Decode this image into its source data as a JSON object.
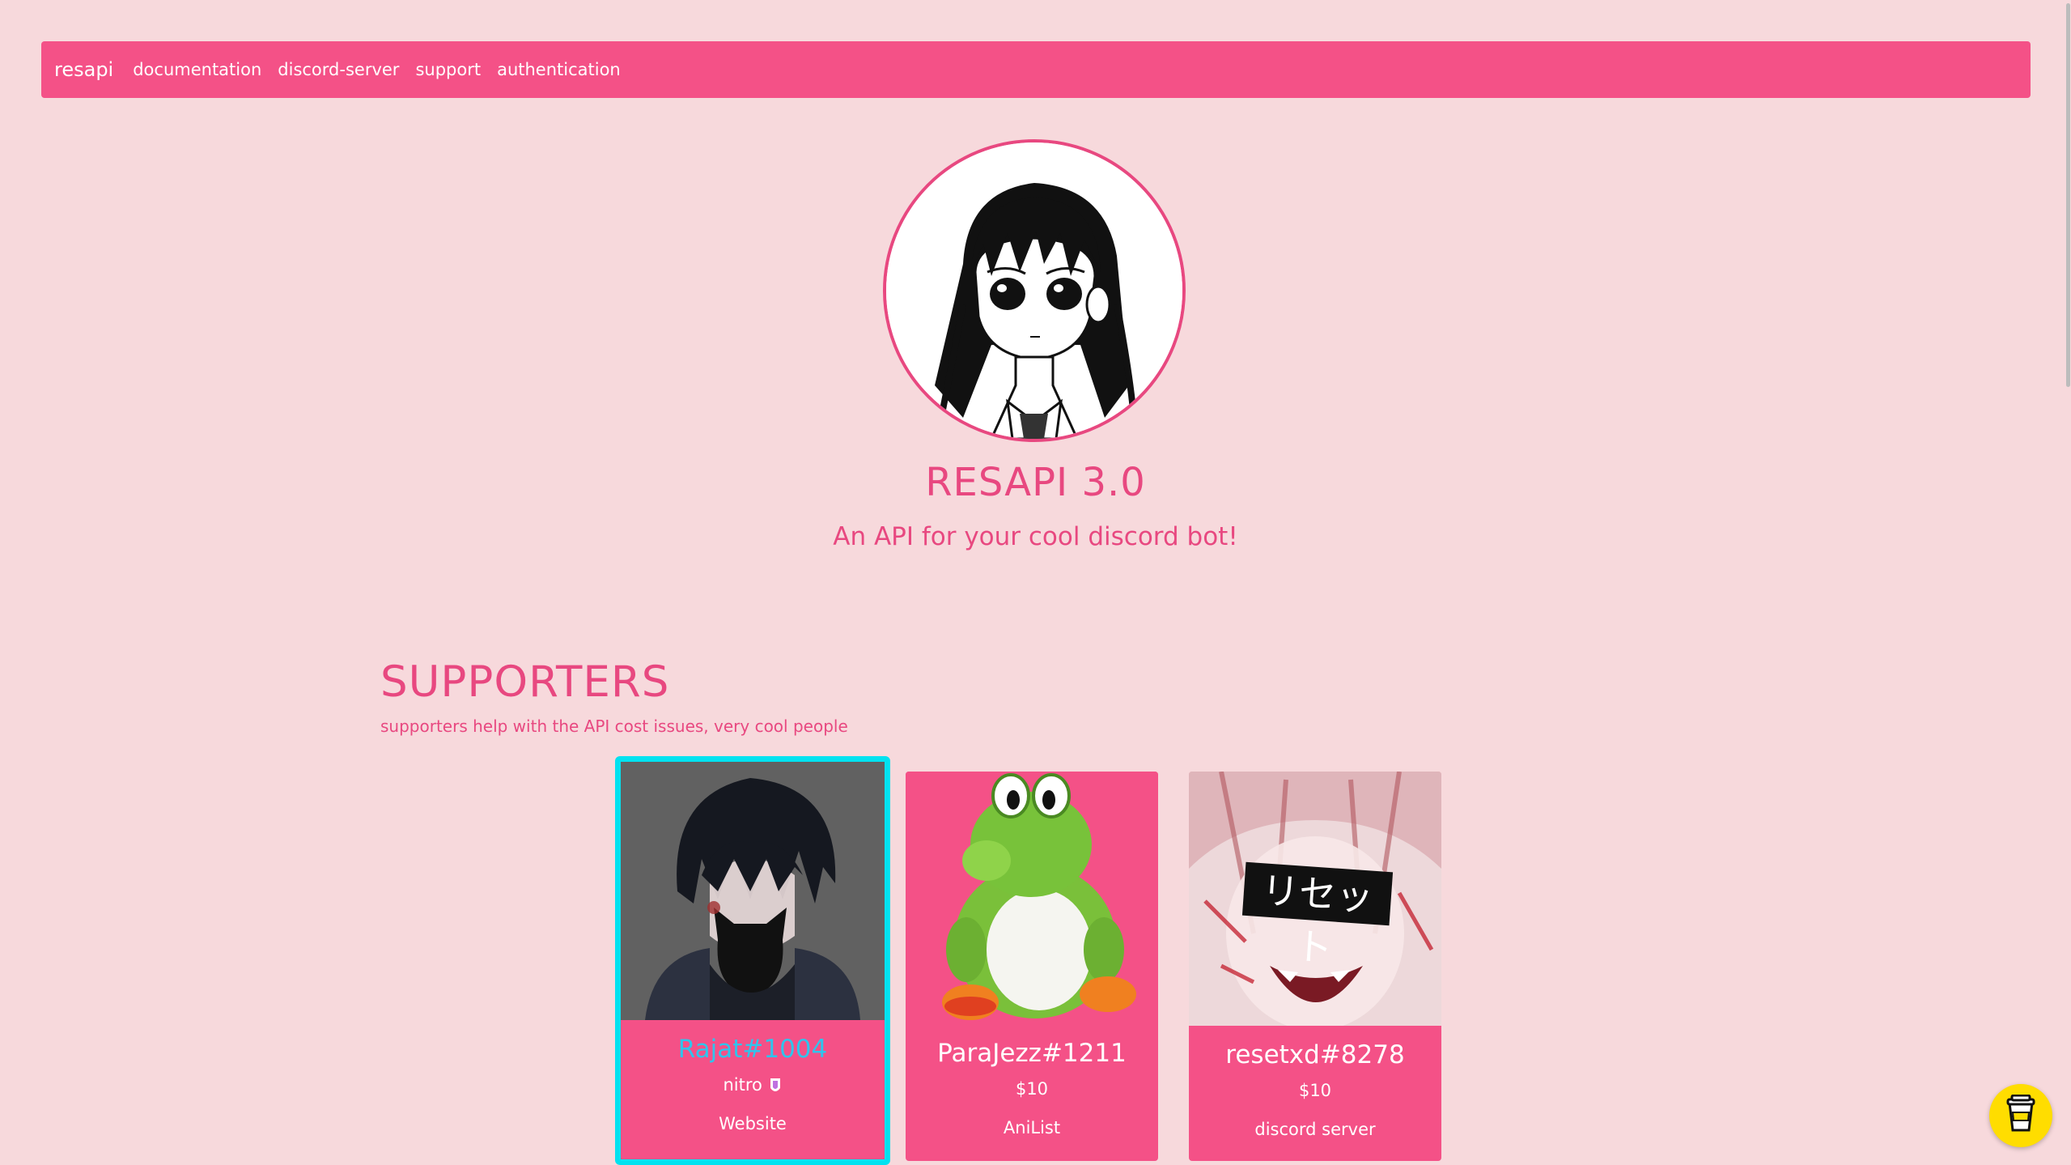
{
  "nav": {
    "brand": "resapi",
    "links": [
      "documentation",
      "discord-server",
      "support",
      "authentication"
    ]
  },
  "hero": {
    "title": "RESAPI 3.0",
    "subtitle": "An API for your cool discord bot!"
  },
  "supporters": {
    "title": "SUPPORTERS",
    "description": "supporters help with the API cost issues, very cool people",
    "cards": [
      {
        "name": "Rajat#1004",
        "amount": "nitro",
        "link": "Website",
        "highlighted": true,
        "name_color": "#2fc4ec"
      },
      {
        "name": "ParaJezz#1211",
        "amount": "$10",
        "link": "AniList",
        "highlighted": false
      },
      {
        "name": "resetxd#8278",
        "amount": "$10",
        "link": "discord server",
        "highlighted": false,
        "image_text": "リセット"
      }
    ]
  },
  "colors": {
    "background": "#f7d9dc",
    "accent": "#f45187",
    "title_pink": "#e84880",
    "highlight_cyan": "#00e2f0",
    "coffee_button": "#ffdd00"
  },
  "icons": {
    "coffee_button": "coffee-cup-icon"
  }
}
